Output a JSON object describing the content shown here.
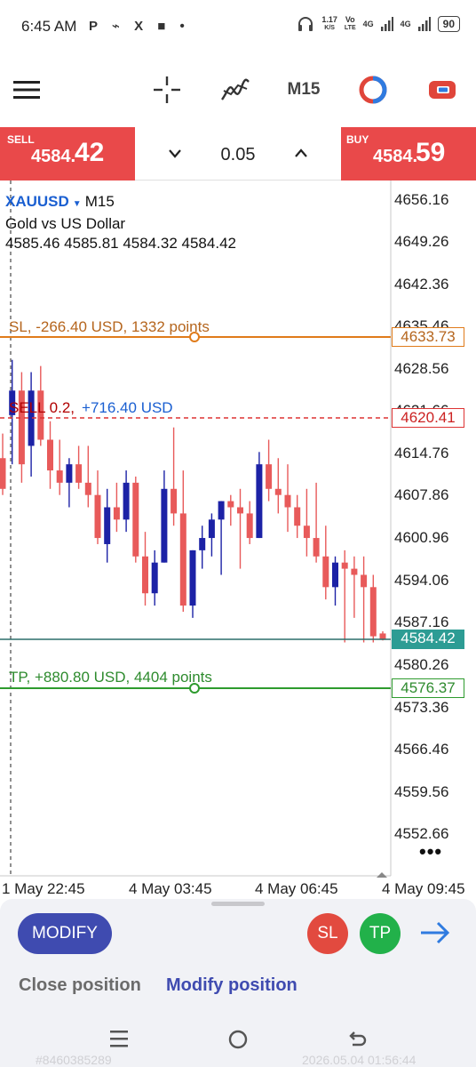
{
  "status_bar": {
    "time": "6:45 AM",
    "notification_icons": "P ⌁ X ■ •",
    "speed": "1.17",
    "speed_unit": "K/S",
    "vo": "Vo",
    "lte": "LTE",
    "net1": "4G",
    "net2": "4G",
    "battery": "90"
  },
  "toolbar": {
    "timeframe": "M15",
    "icons": [
      "menu-icon",
      "crosshair-icon",
      "indicators-icon",
      "timeframe",
      "chart-type-icon",
      "trade-icon"
    ]
  },
  "trade": {
    "sell_label": "SELL",
    "sell_price_main": "4584.",
    "sell_price_big": "42",
    "buy_label": "BUY",
    "buy_price_main": "4584.",
    "buy_price_big": "59",
    "lot": "0.05",
    "accent_red": "#e9494a"
  },
  "chart": {
    "symbol": "XAUUSD",
    "timeframe": "M15",
    "description": "Gold vs US Dollar",
    "ohlc": "4585.46 4585.81 4584.32 4584.42",
    "sl_label": "SL, -266.40 USD, 1332 points",
    "position_label": "SELL 0.2,",
    "position_pnl": "+716.40 USD",
    "tp_label": "TP, +880.80 USD, 4404 points",
    "price_axis": [
      "4656.16",
      "4649.26",
      "4642.36",
      "4635.46",
      "4628.56",
      "4621.66",
      "4614.76",
      "4607.86",
      "4600.96",
      "4594.06",
      "4587.16",
      "4580.26",
      "4573.36",
      "4566.46",
      "4559.56",
      "4552.66"
    ],
    "sl_price": "4633.73",
    "position_price": "4620.41",
    "current_price": "4584.42",
    "tp_price": "4576.37",
    "time_axis": [
      "1 May 22:45",
      "4 May 03:45",
      "4 May 06:45",
      "4 May 09:45"
    ],
    "colors": {
      "bull": "#1c22a6",
      "bear": "#e85a5a",
      "sl": "#e07b1a",
      "tp": "#2e9b2e",
      "current": "#2d9c94"
    }
  },
  "chart_data": {
    "type": "candlestick",
    "y_axis_ticks": [
      4656.16,
      4649.26,
      4642.36,
      4635.46,
      4628.56,
      4621.66,
      4614.76,
      4607.86,
      4600.96,
      4594.06,
      4587.16,
      4580.26,
      4573.36,
      4566.46,
      4559.56,
      4552.66
    ],
    "candles": [
      [
        4614,
        4618,
        4608,
        4609
      ],
      [
        4621,
        4630,
        4613,
        4625
      ],
      [
        4625,
        4628,
        4610,
        4613
      ],
      [
        4616,
        4628,
        4611,
        4625
      ],
      [
        4625,
        4629,
        4616,
        4617
      ],
      [
        4617,
        4620,
        4609,
        4612
      ],
      [
        4612,
        4617,
        4608,
        4610
      ],
      [
        4610,
        4614,
        4606,
        4613
      ],
      [
        4613,
        4616,
        4609,
        4610
      ],
      [
        4610,
        4616,
        4606,
        4608
      ],
      [
        4608,
        4612,
        4600,
        4601
      ],
      [
        4600,
        4609,
        4597,
        4606
      ],
      [
        4606,
        4610,
        4602,
        4604
      ],
      [
        4604,
        4612,
        4602,
        4610
      ],
      [
        4610,
        4611,
        4597,
        4598
      ],
      [
        4598,
        4602,
        4590,
        4592
      ],
      [
        4592,
        4599,
        4590,
        4597
      ],
      [
        4597,
        4612,
        4597,
        4609
      ],
      [
        4609,
        4619,
        4603,
        4605
      ],
      [
        4605,
        4612,
        4589,
        4590
      ],
      [
        4590,
        4599,
        4588,
        4599
      ],
      [
        4599,
        4603,
        4596,
        4601
      ],
      [
        4601,
        4605,
        4598,
        4604
      ],
      [
        4604,
        4607,
        4595,
        4607
      ],
      [
        4607,
        4608,
        4603,
        4606
      ],
      [
        4606,
        4609,
        4596,
        4605
      ],
      [
        4605,
        4607,
        4600,
        4601
      ],
      [
        4601,
        4615,
        4601,
        4613
      ],
      [
        4613,
        4617,
        4607,
        4609
      ],
      [
        4609,
        4614,
        4605,
        4608
      ],
      [
        4608,
        4613,
        4602,
        4606
      ],
      [
        4606,
        4608,
        4601,
        4603
      ],
      [
        4603,
        4609,
        4598,
        4601
      ],
      [
        4601,
        4610,
        4597,
        4598
      ],
      [
        4598,
        4603,
        4591,
        4593
      ],
      [
        4593,
        4598,
        4590,
        4597
      ],
      [
        4597,
        4599,
        4584,
        4596
      ],
      [
        4596,
        4598,
        4588,
        4595
      ],
      [
        4595,
        4598,
        4584,
        4593
      ],
      [
        4593,
        4595,
        4584,
        4585
      ],
      [
        4585.46,
        4585.81,
        4584.32,
        4584.42
      ]
    ]
  },
  "bottom_panel": {
    "modify_button": "MODIFY",
    "sl_button": "SL",
    "tp_button": "TP",
    "tab_close": "Close position",
    "tab_modify": "Modify position",
    "watermark_id": "#8460385289",
    "watermark_time": "2026.05.04 01:56:44"
  }
}
